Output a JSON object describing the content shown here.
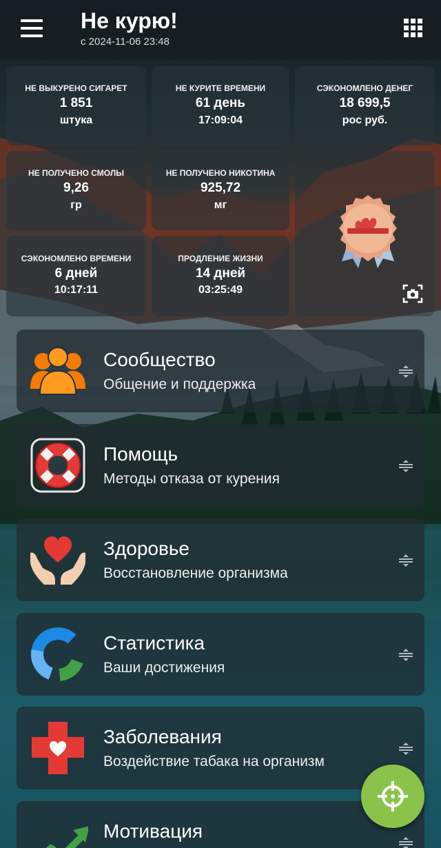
{
  "header": {
    "title": "Не курю!",
    "subtitle": "с 2024-11-06 23:48",
    "menu_icon": "hamburger-menu-icon",
    "apps_icon": "grid-apps-icon"
  },
  "stats": [
    {
      "label": "НЕ ВЫКУРЕНО СИГАРЕТ",
      "value": "1 851",
      "unit": "штука"
    },
    {
      "label": "НЕ КУРИТЕ ВРЕМЕНИ",
      "value": "61 день",
      "unit": "17:09:04"
    },
    {
      "label": "СЭКОНОМЛЕНО ДЕНЕГ",
      "value": "18 699,5",
      "unit": "рос руб."
    },
    {
      "label": "НЕ ПОЛУЧЕНО СМОЛЫ",
      "value": "9,26",
      "unit": "гр"
    },
    {
      "label": "НЕ ПОЛУЧЕНО НИКОТИНА",
      "value": "925,72",
      "unit": "мг"
    },
    {
      "label": "СЭКОНОМЛЕНО ВРЕМЕНИ",
      "value": "6 дней",
      "unit": "10:17:11"
    },
    {
      "label": "ПРОДЛЕНИЕ ЖИЗНИ",
      "value": "14 дней",
      "unit": "03:25:49"
    }
  ],
  "badge": {
    "icon": "achievement-badge-icon",
    "camera_icon": "screenshot-camera-icon"
  },
  "menu": [
    {
      "title": "Сообщество",
      "subtitle": "Общение и поддержка",
      "icon": "community-people-icon"
    },
    {
      "title": "Помощь",
      "subtitle": "Методы отказа от курения",
      "icon": "lifebuoy-icon"
    },
    {
      "title": "Здоровье",
      "subtitle": "Восстановление организма",
      "icon": "heart-hands-icon"
    },
    {
      "title": "Статистика",
      "subtitle": "Ваши достижения",
      "icon": "donut-chart-icon"
    },
    {
      "title": "Заболевания",
      "subtitle": "Воздействие табака на организм",
      "icon": "medical-cross-icon"
    },
    {
      "title": "Мотивация",
      "subtitle": "",
      "icon": "growth-arrow-icon"
    }
  ],
  "fab": {
    "icon": "crosshair-target-icon"
  },
  "colors": {
    "accent": "#8bc34a",
    "header_bg": "#161e22",
    "tile_bg": "#28343a"
  }
}
